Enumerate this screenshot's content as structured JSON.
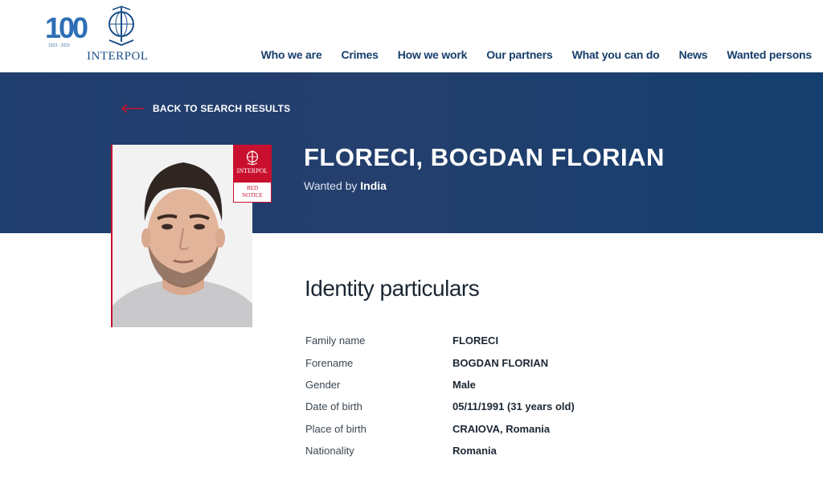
{
  "header": {
    "logo_number": "100",
    "logo_word": "INTERPOL",
    "logo_subtitle": "1923 - 2023",
    "nav": [
      {
        "label": "Who we are"
      },
      {
        "label": "Crimes"
      },
      {
        "label": "How we work"
      },
      {
        "label": "Our partners"
      },
      {
        "label": "What you can do"
      },
      {
        "label": "News"
      },
      {
        "label": "Wanted persons"
      }
    ]
  },
  "banner": {
    "back_label": "BACK TO SEARCH RESULTS",
    "name": "FLORECI, BOGDAN FLORIAN",
    "wanted_prefix": "Wanted by",
    "wanted_country": "India"
  },
  "badge": {
    "word": "INTERPOL",
    "line1": "RED",
    "line2": "NOTICE"
  },
  "identity": {
    "title": "Identity particulars",
    "rows": [
      {
        "label": "Family name",
        "value": "FLORECI"
      },
      {
        "label": "Forename",
        "value": "BOGDAN FLORIAN"
      },
      {
        "label": "Gender",
        "value": "Male"
      },
      {
        "label": "Date of birth",
        "value": "05/11/1991 (31 years old)"
      },
      {
        "label": "Place of birth",
        "value": "CRAIOVA, Romania"
      },
      {
        "label": "Nationality",
        "value": "Romania"
      }
    ]
  },
  "colors": {
    "banner": "#1f3d6e",
    "nav_text": "#173e6b",
    "red_notice": "#c8102e"
  }
}
